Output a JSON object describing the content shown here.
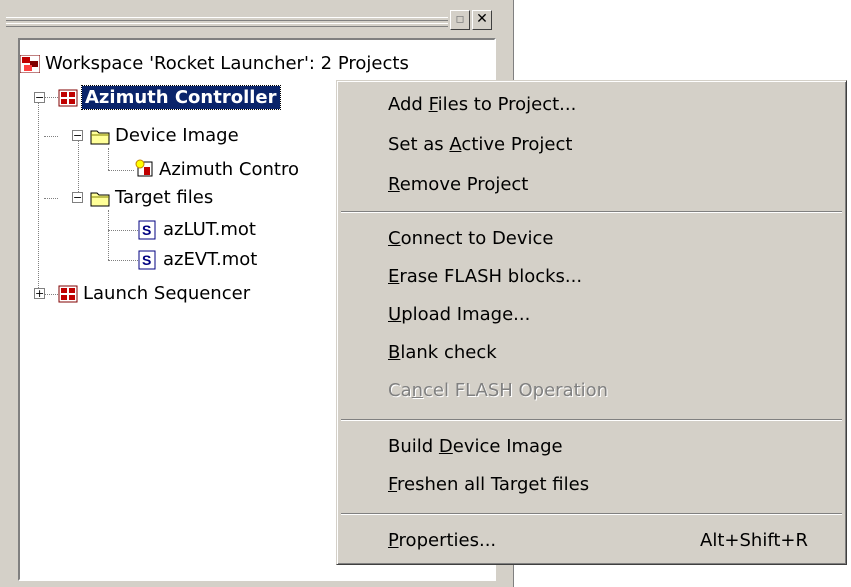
{
  "window": {
    "restore_glyph": "▫",
    "close_glyph": "✕"
  },
  "tree": {
    "workspace": "Workspace 'Rocket Launcher': 2 Projects",
    "project1": "Azimuth Controller",
    "device_image": "Device Image",
    "azimuth_item": "Azimuth Contro",
    "target_files": "Target files",
    "file1": "azLUT.mot",
    "file2": "azEVT.mot",
    "project2": "Launch Sequencer",
    "expanded_glyph": "−",
    "collapsed_glyph": "+"
  },
  "menu": {
    "items": [
      {
        "label": "Add Files to Project...",
        "mnemonic": "F"
      },
      {
        "label": "Set as Active Project",
        "mnemonic": "A"
      },
      {
        "label": "Remove Project",
        "mnemonic": "R"
      },
      {
        "label": "Connect to Device",
        "mnemonic": "C"
      },
      {
        "label": "Erase FLASH blocks...",
        "mnemonic": "E"
      },
      {
        "label": "Upload Image...",
        "mnemonic": "U"
      },
      {
        "label": "Blank check",
        "mnemonic": "B"
      },
      {
        "label": "Cancel FLASH Operation",
        "mnemonic": "n",
        "disabled": true
      },
      {
        "label": "Build Device Image",
        "mnemonic": "D"
      },
      {
        "label": "Freshen all Target files",
        "mnemonic": "F"
      },
      {
        "label": "Properties...",
        "mnemonic": "P",
        "accelerator": "Alt+Shift+R"
      }
    ]
  },
  "colors": {
    "face": "#d4d0c8",
    "selection": "#0a246a",
    "disabled_text": "#808080"
  }
}
